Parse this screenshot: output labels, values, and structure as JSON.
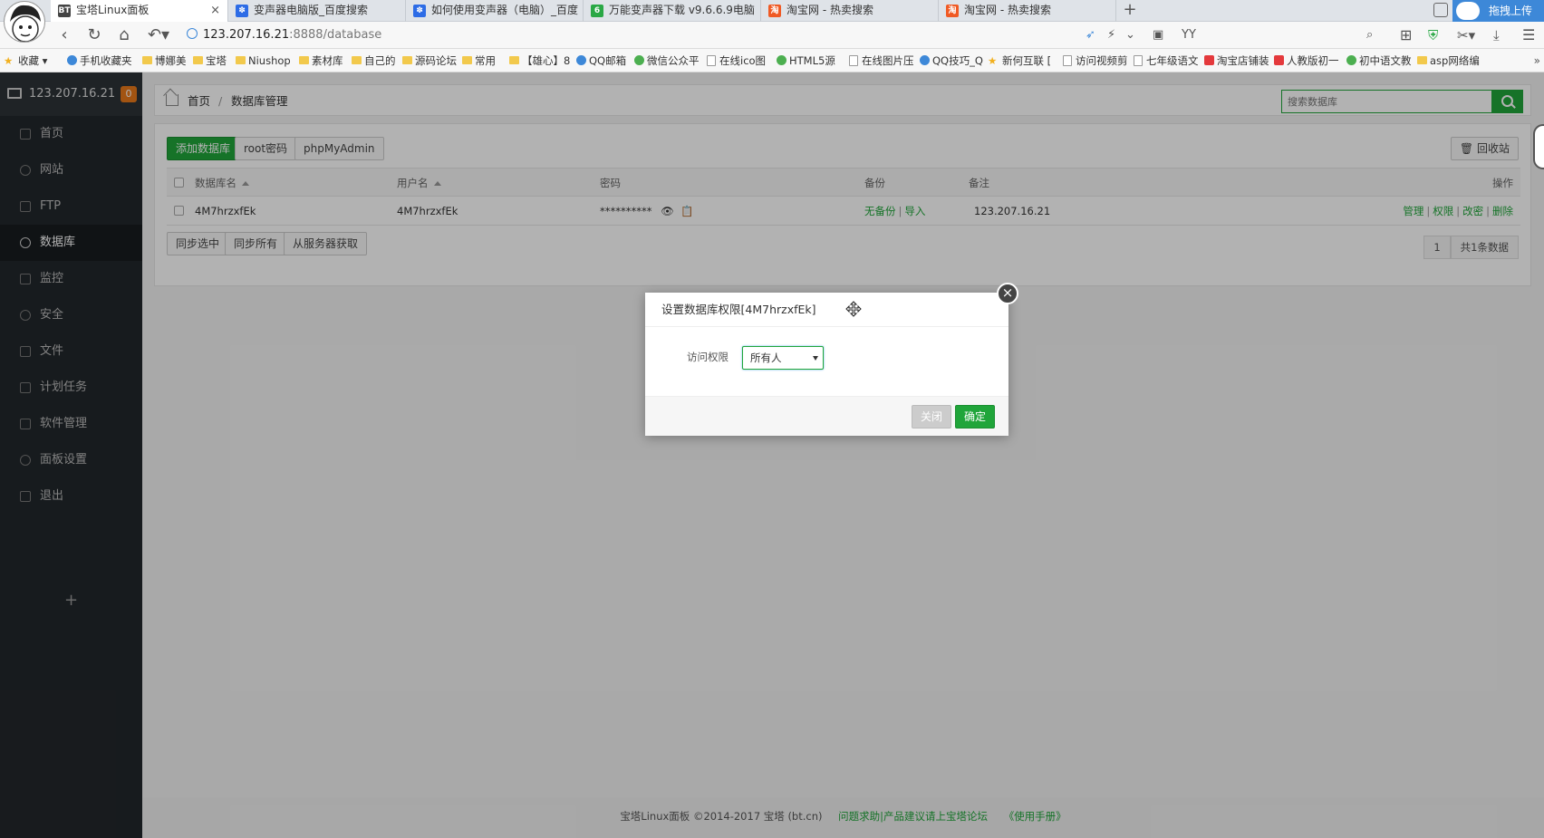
{
  "browser": {
    "tabs": [
      {
        "label": "宝塔Linux面板",
        "icon": "BT",
        "icon_color": "#444444",
        "active": true
      },
      {
        "label": "变声器电脑版_百度搜索",
        "icon": "paw",
        "icon_color": "#2d6ce6",
        "active": false
      },
      {
        "label": "如何使用变声器（电脑）_百度",
        "icon": "paw",
        "icon_color": "#2d6ce6",
        "active": false
      },
      {
        "label": "万能变声器下载 v9.6.6.9电脑",
        "icon": "6",
        "icon_color": "#2aa845",
        "active": false
      },
      {
        "label": "淘宝网 - 热卖搜索",
        "icon": "taobao",
        "icon_color": "#f05a24",
        "active": false
      },
      {
        "label": "淘宝网 - 热卖搜索",
        "icon": "taobao",
        "icon_color": "#f05a24",
        "active": false
      }
    ],
    "tab_close": "×",
    "new_tab": "+",
    "upload_label": "拖拽上传",
    "url_host": "123.207.16.21",
    "url_rest": ":8888/database",
    "search_engine_text": "YY",
    "bookmarks": [
      {
        "label": "收藏",
        "kind": "star"
      },
      {
        "label": "手机收藏夹",
        "kind": "blue"
      },
      {
        "label": "博娜美",
        "kind": "folder"
      },
      {
        "label": "宝塔",
        "kind": "folder"
      },
      {
        "label": "Niushop",
        "kind": "folder"
      },
      {
        "label": "素材库",
        "kind": "folder"
      },
      {
        "label": "自己的",
        "kind": "folder"
      },
      {
        "label": "源码论坛",
        "kind": "folder"
      },
      {
        "label": "常用",
        "kind": "folder"
      },
      {
        "label": "【雄心】8",
        "kind": "folder"
      },
      {
        "label": "QQ邮箱",
        "kind": "blue"
      },
      {
        "label": "微信公众平",
        "kind": "green"
      },
      {
        "label": "在线ico图",
        "kind": "page"
      },
      {
        "label": "HTML5源",
        "kind": "green"
      },
      {
        "label": "在线图片压",
        "kind": "page"
      },
      {
        "label": "QQ技巧_Q",
        "kind": "blue"
      },
      {
        "label": "新何互联 [",
        "kind": "star"
      },
      {
        "label": "访问视频剪",
        "kind": "page"
      },
      {
        "label": "七年级语文",
        "kind": "page"
      },
      {
        "label": "淘宝店铺装",
        "kind": "app"
      },
      {
        "label": "人教版初一",
        "kind": "app"
      },
      {
        "label": "初中语文教",
        "kind": "green"
      },
      {
        "label": "asp网络编",
        "kind": "folder"
      }
    ],
    "bookmarks_more": "»"
  },
  "sidebar": {
    "server_ip": "123.207.16.21",
    "badge": "0",
    "items": [
      {
        "label": "首页",
        "icon": "home-icon"
      },
      {
        "label": "网站",
        "icon": "globe-icon"
      },
      {
        "label": "FTP",
        "icon": "ftp-icon"
      },
      {
        "label": "数据库",
        "icon": "database-icon",
        "active": true
      },
      {
        "label": "监控",
        "icon": "monitor-icon"
      },
      {
        "label": "安全",
        "icon": "shield-icon"
      },
      {
        "label": "文件",
        "icon": "folder-icon"
      },
      {
        "label": "计划任务",
        "icon": "calendar-icon"
      },
      {
        "label": "软件管理",
        "icon": "apps-icon"
      },
      {
        "label": "面板设置",
        "icon": "gear-icon"
      },
      {
        "label": "退出",
        "icon": "logout-icon"
      }
    ],
    "add": "+"
  },
  "header": {
    "crumb_home": "首页",
    "crumb_sep": "/",
    "crumb_current": "数据库管理",
    "search_placeholder": "搜索数据库"
  },
  "toolbar": {
    "add_db": "添加数据库",
    "root_pw": "root密码",
    "phpmyadmin": "phpMyAdmin",
    "recycle": "回收站"
  },
  "table": {
    "columns": [
      "数据库名",
      "用户名",
      "密码",
      "备份",
      "备注",
      "操作"
    ],
    "rows": [
      {
        "name": "4M7hrzxfEk",
        "user": "4M7hrzxfEk",
        "password": "**********",
        "backup_none": "无备份",
        "backup_import": "导入",
        "note": "123.207.16.21",
        "actions": [
          "管理",
          "权限",
          "改密",
          "删除"
        ]
      }
    ]
  },
  "bottom": {
    "sync_selected": "同步选中",
    "sync_all": "同步所有",
    "fetch_server": "从服务器获取",
    "page": "1",
    "total": "共1条数据"
  },
  "footer": {
    "copyright": "宝塔Linux面板 ©2014-2017 宝塔 (bt.cn)",
    "forum": "问题求助|产品建议请上宝塔论坛",
    "manual": "《使用手册》"
  },
  "dialog": {
    "title": "设置数据库权限[4M7hrzxfEk]",
    "label": "访问权限",
    "selected": "所有人",
    "close_btn": "关闭",
    "ok_btn": "确定",
    "close_x": "×"
  },
  "colors": {
    "accent": "#20a53a",
    "sidebar_bg": "#22272b",
    "badge": "#e8791b"
  }
}
